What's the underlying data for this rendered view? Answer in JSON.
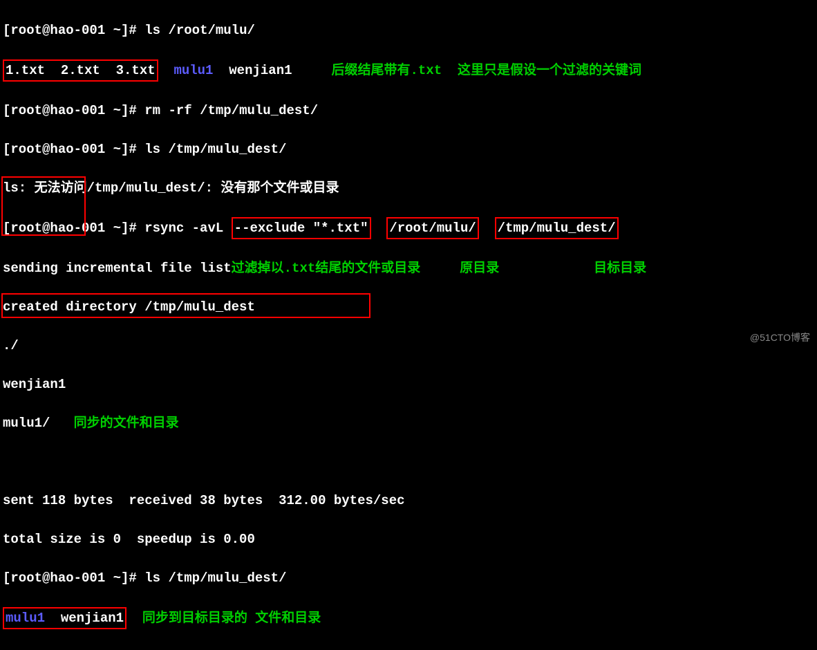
{
  "prompt": "[root@hao-001 ~]#",
  "cmd_ls_root": "ls /root/mulu/",
  "files_txt": "1.txt  2.txt  3.txt",
  "mulu1": "mulu1",
  "wenjian1": "wenjian1",
  "annot1a": "后缀结尾带有.txt",
  "annot1b": "这里只是假设一个过滤的关键词",
  "cmd_rm": "rm -rf /tmp/mulu_dest/",
  "cmd_ls_dest": "ls /tmp/mulu_dest/",
  "ls_error": "ls: 无法访问/tmp/mulu_dest/: 没有那个文件或目录",
  "rsync_pre": " rsync -avL ",
  "rsync_exclude": "--exclude \"*.txt\"",
  "rsync_src": "/root/mulu/",
  "rsync_dst": "/tmp/mulu_dest/",
  "sending": "sending incremental file list",
  "annot_exclude": "过滤掉以.txt结尾的文件或目录",
  "annot_src": "原目录",
  "annot_dst": "目标目录",
  "created": "created directory /tmp/mulu_dest",
  "dot": "./",
  "mulu1_slash": "mulu1/",
  "annot_sync": "同步的文件和目录",
  "sent": "sent 118 bytes  received 38 bytes  312.00 bytes/sec",
  "total": "total size is 0  speedup is 0.00",
  "cmd_ls_dest2": "ls /tmp/mulu_dest/",
  "annot_result": "同步到目标目录的 文件和目录",
  "watermark": "@51CTO博客"
}
